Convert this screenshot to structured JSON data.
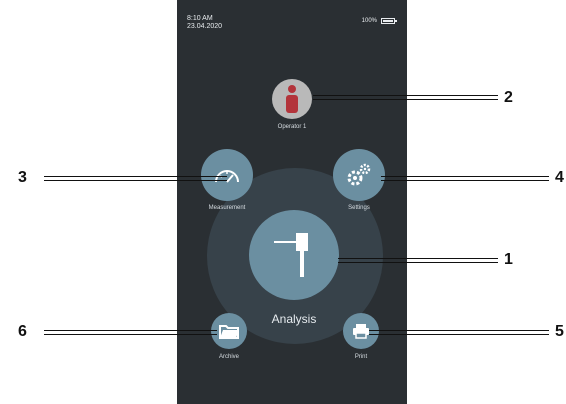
{
  "status": {
    "time": "8:10 AM",
    "date": "23.04.2020",
    "battery_text": "100%",
    "battery_level": 1.0
  },
  "operator": {
    "label": "Operator 1",
    "icon": "user-info-icon",
    "accent": "#b3343b"
  },
  "nav": {
    "measurement": {
      "label": "Measurement",
      "icon": "gauge-icon"
    },
    "settings": {
      "label": "Settings",
      "icon": "gears-icon"
    },
    "analysis": {
      "label": "Analysis",
      "icon": "probe-icon"
    },
    "archive": {
      "label": "Archive",
      "icon": "folder-icon"
    },
    "print": {
      "label": "Print",
      "icon": "printer-icon"
    }
  },
  "callouts": {
    "c1": "1",
    "c2": "2",
    "c3": "3",
    "c4": "4",
    "c5": "5",
    "c6": "6"
  },
  "colors": {
    "screen_bg": "#2a2f33",
    "ring_bg": "#37424a",
    "button_bg": "#6b8fa1",
    "operator_bg": "#b9b9b9"
  }
}
